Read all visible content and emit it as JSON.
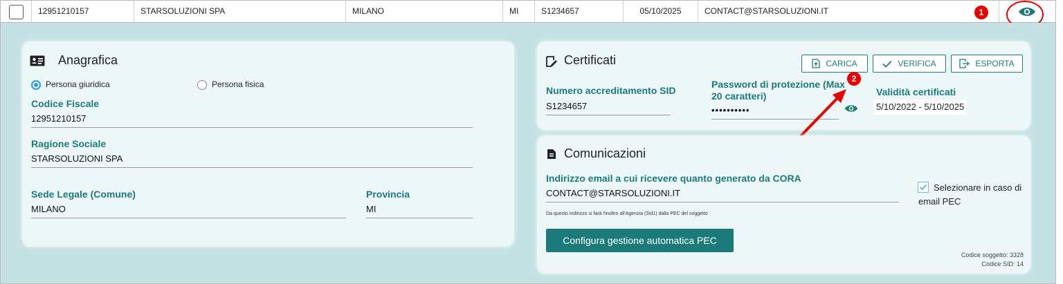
{
  "row": {
    "codice_fiscale": "12951210157",
    "ragione_sociale": "STARSOLUZIONI SPA",
    "comune": "MILANO",
    "provincia": "MI",
    "sid": "S1234657",
    "data": "05/10/2025",
    "email": "CONTACT@STARSOLUZIONI.IT",
    "callout_1": "1",
    "view_icon": "eye-icon"
  },
  "anagrafica": {
    "title": "Anagrafica",
    "icon": "id-card-icon",
    "radio_giuridica": "Persona giuridica",
    "radio_fisica": "Persona fisica",
    "selected": "Persona giuridica",
    "cf_label": "Codice Fiscale",
    "cf_value": "12951210157",
    "rs_label": "Ragione Sociale",
    "rs_value": "STARSOLUZIONI SPA",
    "sede_label": "Sede Legale (Comune)",
    "sede_value": "MILANO",
    "prov_label": "Provincia",
    "prov_value": "MI"
  },
  "certificati": {
    "title": "Certificati",
    "icon": "certificate-icon",
    "carica": "CARICA",
    "verifica": "VERIFICA",
    "esporta": "ESPORTA",
    "sid_label": "Numero accreditamento SID",
    "sid_value": "S1234657",
    "pwd_label": "Password di protezione (Max 20 caratteri)",
    "pwd_value": "••••••••••",
    "validita_label": "Validità certificati",
    "validita_value": "5/10/2022 - 5/10/2025",
    "callout_2": "2"
  },
  "comunicazioni": {
    "title": "Comunicazioni",
    "icon": "document-icon",
    "email_label": "Indirizzo email a cui ricevere quanto generato da CORA",
    "email_value": "CONTACT@STARSOLUZIONI.IT",
    "pec_checkbox": "Selezionare in caso di email PEC",
    "pec_checked": true,
    "note": "Da questo indirizzo si farà l'inoltro all'Agenzia (Sid1) dalla PEC del soggetto",
    "configura": "Configura gestione automatica PEC",
    "codice_soggetto": "Codice soggetto: 3328",
    "codice_sid": "Codice SID: 14"
  },
  "colors": {
    "accent": "#1b7b7b",
    "detail_bg": "#c4e1e4",
    "callout": "#e60000"
  }
}
